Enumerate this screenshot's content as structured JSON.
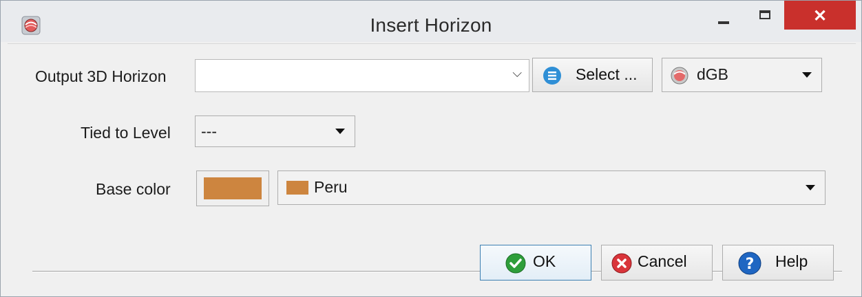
{
  "window": {
    "title": "Insert Horizon",
    "close_glyph": "✕",
    "icon": "app-logo-icon"
  },
  "output_horizon": {
    "label": "Output 3D Horizon",
    "value": "",
    "select_label": "Select ...",
    "select_icon": "list-icon",
    "survey_label": "dGB",
    "survey_icon": "dgb-logo-icon"
  },
  "tied_to_level": {
    "label": "Tied to Level",
    "value": "---"
  },
  "base_color": {
    "label": "Base color",
    "color": "#cd853f",
    "color_name": "Peru"
  },
  "buttons": {
    "ok": "OK",
    "cancel": "Cancel",
    "help": "Help"
  },
  "colors": {
    "ok_green": "#2e9e3a",
    "cancel_red": "#d9343a",
    "help_blue": "#1f66c2",
    "select_blue": "#2f8fd6",
    "close_red": "#c9302c"
  }
}
